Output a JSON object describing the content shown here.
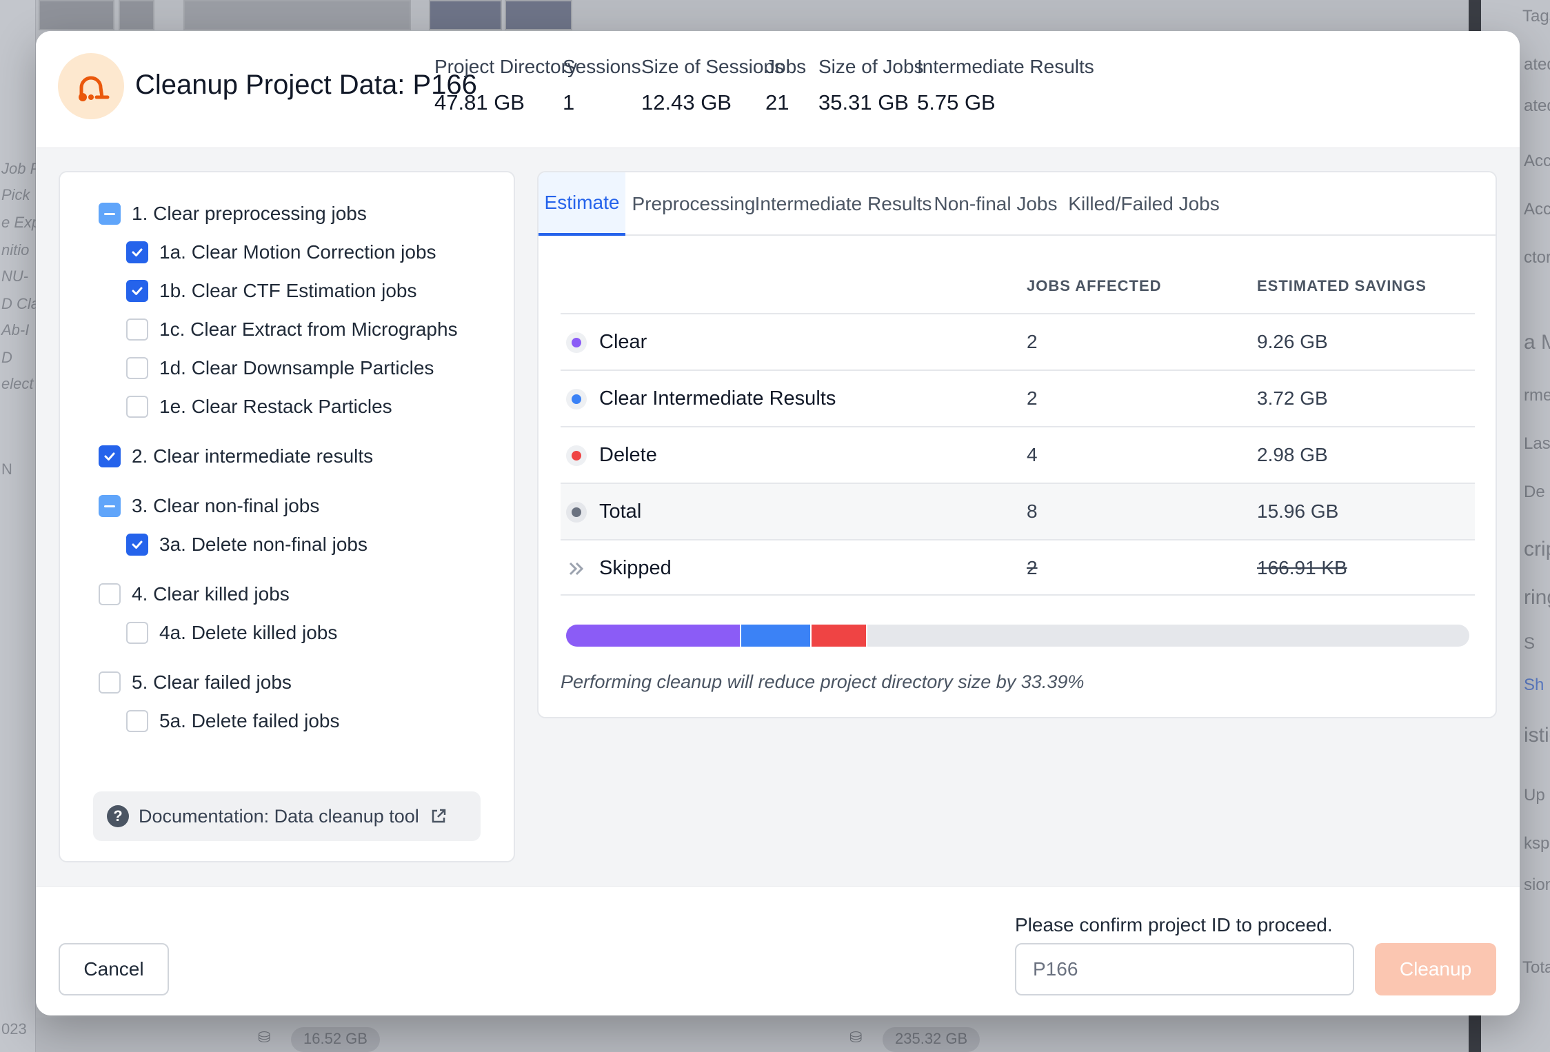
{
  "background": {
    "left_labels": [
      "Job P",
      "Pick",
      "e Exp",
      "nitio",
      "NU-",
      "D Cla",
      "Ab-I",
      "D",
      "elect",
      "N"
    ],
    "right_labels": [
      "Tags",
      "ated",
      "ated",
      "Acc",
      "Acc",
      "ctor",
      "a Ma",
      "rme",
      "Las",
      "De",
      "crip",
      "ring",
      "S",
      "Sh",
      "istic",
      "Up",
      "ksp",
      "sion",
      "Total Ja"
    ],
    "bottom_sizes": [
      "16.52 GB",
      "235.32 GB"
    ],
    "bottom_year": "023"
  },
  "modal": {
    "title": "Cleanup Project Data: P166",
    "logo_icon": "vacuum-icon",
    "stats": [
      {
        "label": "Project Directory",
        "value": "47.81 GB"
      },
      {
        "label": "Sessions",
        "value": "1"
      },
      {
        "label": "Size of Sessions",
        "value": "12.43 GB"
      },
      {
        "label": "Jobs",
        "value": "21"
      },
      {
        "label": "Size of Jobs",
        "value": "35.31 GB"
      },
      {
        "label": "Intermediate Results",
        "value": "5.75 GB"
      }
    ]
  },
  "options": [
    {
      "label": "1. Clear preprocessing jobs",
      "state": "indeterminate"
    },
    {
      "label": "1a. Clear Motion Correction jobs",
      "state": "checked"
    },
    {
      "label": "1b. Clear CTF Estimation jobs",
      "state": "checked"
    },
    {
      "label": "1c. Clear Extract from Micrographs",
      "state": "unchecked"
    },
    {
      "label": "1d. Clear Downsample Particles",
      "state": "unchecked"
    },
    {
      "label": "1e. Clear Restack Particles",
      "state": "unchecked"
    },
    {
      "label": "2. Clear intermediate results",
      "state": "checked"
    },
    {
      "label": "3. Clear non-final jobs",
      "state": "indeterminate"
    },
    {
      "label": "3a. Delete non-final jobs",
      "state": "checked"
    },
    {
      "label": "4. Clear killed jobs",
      "state": "unchecked"
    },
    {
      "label": "4a. Delete killed jobs",
      "state": "unchecked"
    },
    {
      "label": "5. Clear failed jobs",
      "state": "unchecked"
    },
    {
      "label": "5a. Delete failed jobs",
      "state": "unchecked"
    }
  ],
  "doc_link": {
    "label": "Documentation: Data cleanup tool",
    "icon": "question-circle-icon",
    "ext_icon": "external-link-icon"
  },
  "tabs": [
    "Estimate",
    "Preprocessing",
    "Intermediate Results",
    "Non-final Jobs",
    "Killed/Failed Jobs"
  ],
  "active_tab": "Estimate",
  "table": {
    "headers": {
      "jobs": "JOBS AFFECTED",
      "savings": "ESTIMATED SAVINGS"
    },
    "rows": [
      {
        "label": "Clear",
        "jobs": "2",
        "savings": "9.26 GB",
        "color": "#8b5cf6"
      },
      {
        "label": "Clear Intermediate Results",
        "jobs": "2",
        "savings": "3.72 GB",
        "color": "#3b82f6"
      },
      {
        "label": "Delete",
        "jobs": "4",
        "savings": "2.98 GB",
        "color": "#ef4444"
      },
      {
        "label": "Total",
        "jobs": "8",
        "savings": "15.96 GB",
        "color": "#6b7280"
      },
      {
        "label": "Skipped",
        "jobs": "2",
        "savings": "166.91 KB",
        "icon": "double-chevron-right-icon"
      }
    ]
  },
  "progress": {
    "segments": [
      {
        "name": "clear",
        "gb": 9.26,
        "color": "#8b5cf6"
      },
      {
        "name": "clear-intermediate",
        "gb": 3.72,
        "color": "#3b82f6"
      },
      {
        "name": "delete",
        "gb": 2.98,
        "color": "#ef4444"
      }
    ],
    "total_gb": 47.81,
    "track_color": "#e5e7eb"
  },
  "reduction_note": "Performing cleanup will reduce project directory size by 33.39%",
  "footer": {
    "cancel_label": "Cancel",
    "confirm_label": "Please confirm project ID to proceed.",
    "confirm_value": "P166",
    "cleanup_label": "Cleanup"
  }
}
